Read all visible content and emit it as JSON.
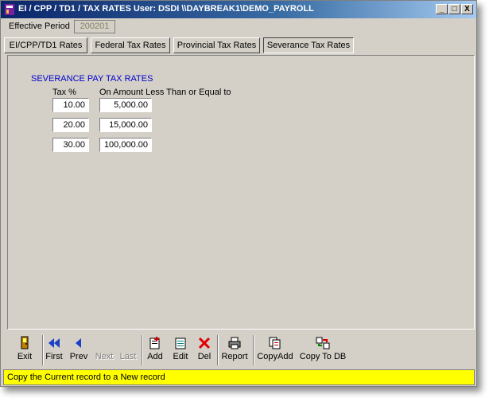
{
  "window": {
    "title": "EI / CPP / TD1 / TAX RATES  User: DSDI  \\\\DAYBREAK1\\DEMO_PAYROLL",
    "controls": {
      "minimize": "_",
      "maximize": "□",
      "close": "X"
    }
  },
  "effective_period": {
    "label": "Effective Period",
    "value": "200201"
  },
  "tabs": [
    {
      "label": "EI/CPP/TD1 Rates"
    },
    {
      "label": "Federal Tax Rates"
    },
    {
      "label": "Provincial Tax Rates"
    },
    {
      "label": "Severance Tax Rates",
      "active": true
    }
  ],
  "severance": {
    "title": "SEVERANCE PAY TAX RATES",
    "col_tax": "Tax %",
    "col_amount": "On Amount Less Than or Equal to",
    "rows": [
      {
        "tax": "10.00",
        "amount": "5,000.00"
      },
      {
        "tax": "20.00",
        "amount": "15,000.00"
      },
      {
        "tax": "30.00",
        "amount": "100,000.00"
      }
    ]
  },
  "toolbar": {
    "exit": "Exit",
    "first": "First",
    "prev": "Prev",
    "next": "Next",
    "last": "Last",
    "add": "Add",
    "edit": "Edit",
    "del": "Del",
    "report": "Report",
    "copyadd": "CopyAdd",
    "copytodb": "Copy To DB"
  },
  "status": {
    "message": "Copy the Current record to a New record"
  },
  "colors": {
    "accent": "#0a246a",
    "status_bg": "#ffff00",
    "section_title": "#0000cc"
  }
}
